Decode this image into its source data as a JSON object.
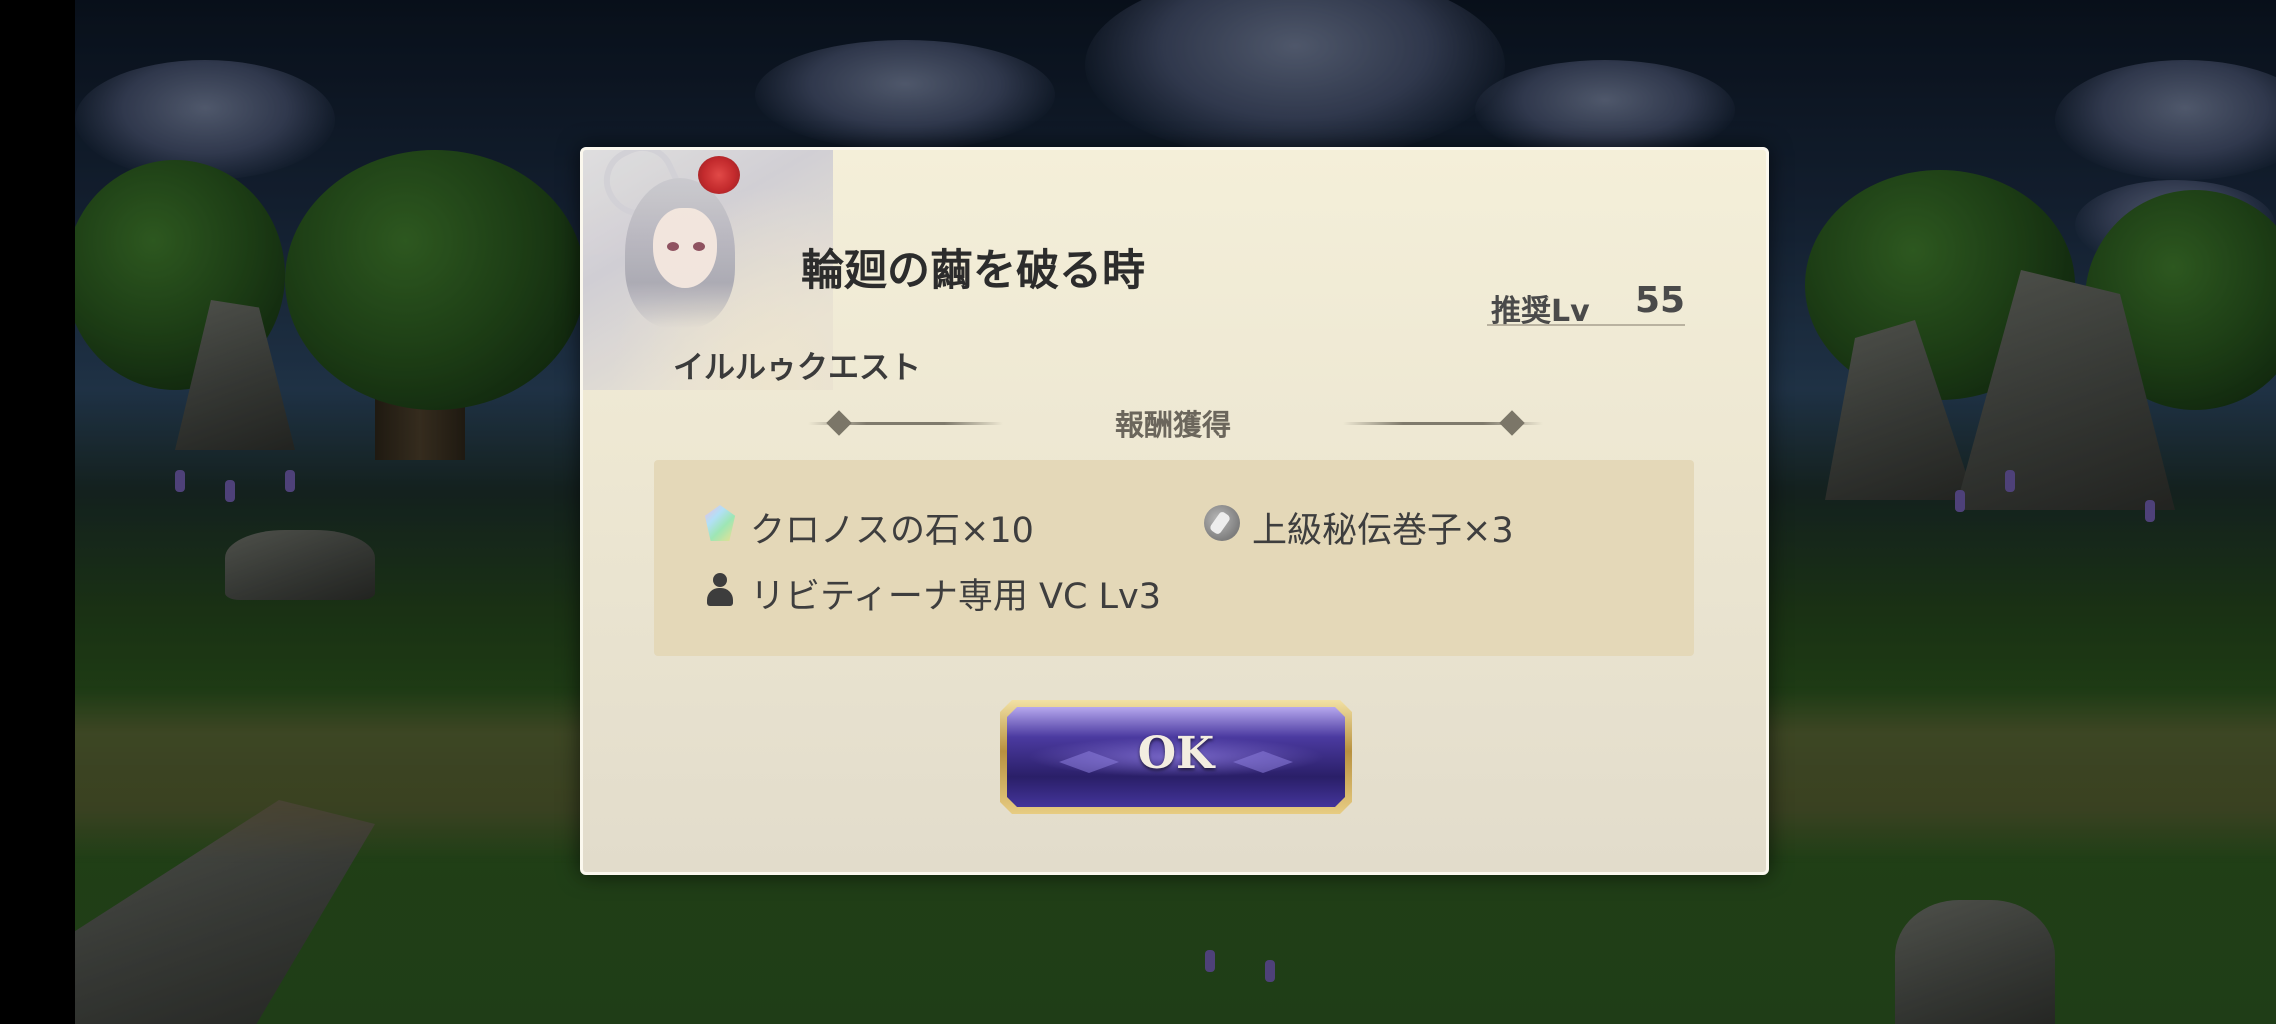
{
  "dialog": {
    "title": "輪廻の繭を破る時",
    "quest_type": "イルルゥクエスト",
    "recommended_level_label": "推奨Lv",
    "recommended_level_value": "55",
    "reward_header": "報酬獲得",
    "rewards": [
      {
        "icon": "chronos-stone-icon",
        "label": "クロノスの石×10"
      },
      {
        "icon": "scroll-icon",
        "label": "上級秘伝巻子×3"
      },
      {
        "icon": "person-icon",
        "label": "リビティーナ専用 VC Lv3"
      }
    ],
    "ok_label": "OK"
  },
  "colors": {
    "dialog_bg": "#f0ead6",
    "reward_box_bg": "#e4d8b8",
    "ok_button": "#3a2b86",
    "ok_frame": "#c9a554"
  }
}
